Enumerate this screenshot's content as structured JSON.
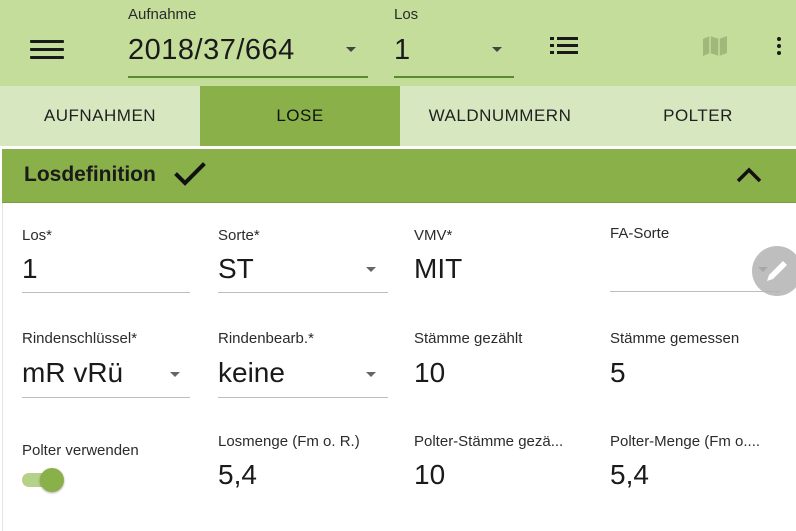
{
  "header": {
    "aufnahme_label": "Aufnahme",
    "aufnahme_value": "2018/37/664",
    "los_label": "Los",
    "los_value": "1",
    "icons": [
      "menu-icon",
      "list-icon",
      "map-icon",
      "more-vert-icon"
    ]
  },
  "tabs": [
    {
      "label": "AUFNAHMEN",
      "active": false
    },
    {
      "label": "LOSE",
      "active": true
    },
    {
      "label": "WALDNUMMERN",
      "active": false
    },
    {
      "label": "POLTER",
      "active": false
    }
  ],
  "section": {
    "title": "Losdefinition",
    "expanded": true
  },
  "fields": {
    "los": {
      "label": "Los*",
      "value": "1"
    },
    "sorte": {
      "label": "Sorte*",
      "value": "ST"
    },
    "vmv": {
      "label": "VMV*",
      "value": "MIT"
    },
    "fa_sorte": {
      "label": "FA-Sorte",
      "value": ""
    },
    "rindenschluessel": {
      "label": "Rindenschlüssel*",
      "value": "mR vRü"
    },
    "rindenbearb": {
      "label": "Rindenbearb.*",
      "value": "keine"
    },
    "staemme_gezaehlt": {
      "label": "Stämme gezählt",
      "value": "10"
    },
    "staemme_gemessen": {
      "label": "Stämme gemessen",
      "value": "5"
    },
    "polter_verwenden": {
      "label": "Polter verwenden",
      "enabled": true
    },
    "losmenge": {
      "label": "Losmenge (Fm o. R.)",
      "value": "5,4"
    },
    "polter_staemme": {
      "label": "Polter-Stämme gezä...",
      "value": "10"
    },
    "polter_menge": {
      "label": "Polter-Menge (Fm o....",
      "value": "5,4"
    }
  },
  "colors": {
    "appbar": "#c5dd9b",
    "tabbar": "#d7e8c1",
    "accent": "#8ab04a",
    "underline": "#5c8a2e"
  }
}
